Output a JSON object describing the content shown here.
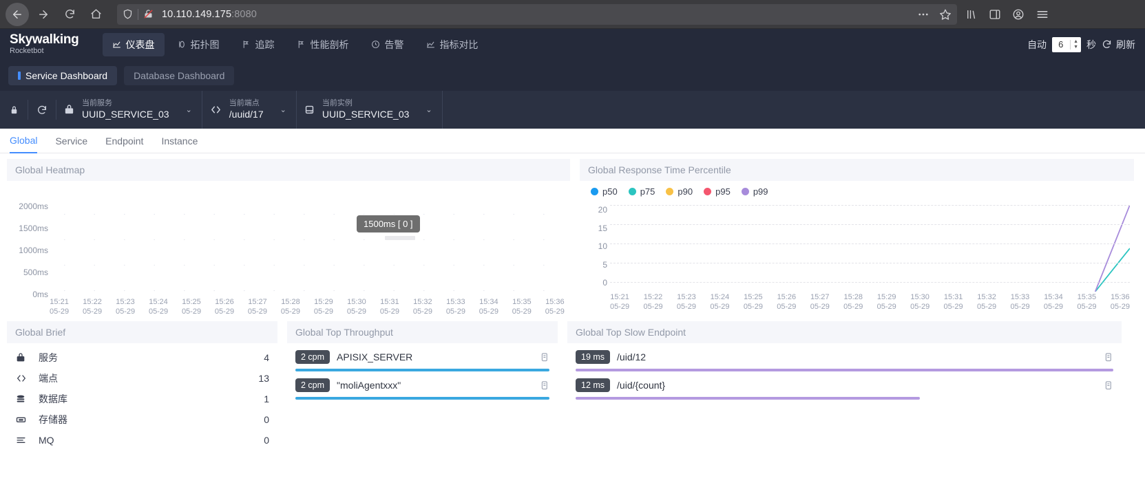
{
  "browser": {
    "url_host": "10.110.149.175",
    "url_port": ":8080",
    "back_icon": "back-arrow-icon",
    "forward_icon": "forward-arrow-icon",
    "reload_icon": "reload-icon",
    "home_icon": "home-icon",
    "shield_icon": "shield-icon",
    "broken-lock_icon": "broken-lock-icon",
    "more_icon": "ellipsis-icon",
    "bookmark_icon": "star-icon",
    "library_icon": "library-icon",
    "sidebar_icon": "sidebar-icon",
    "account_icon": "account-icon",
    "menu_icon": "hamburger-menu-icon"
  },
  "header": {
    "logo_main": "Skywalking",
    "logo_sub": "Rocketbot",
    "nav": [
      {
        "label": "仪表盘",
        "icon": "dashboard-icon",
        "active": true
      },
      {
        "label": "拓扑图",
        "icon": "topology-icon",
        "active": false
      },
      {
        "label": "追踪",
        "icon": "trace-icon",
        "active": false
      },
      {
        "label": "性能剖析",
        "icon": "profile-icon",
        "active": false
      },
      {
        "label": "告警",
        "icon": "alarm-icon",
        "active": false
      },
      {
        "label": "指标对比",
        "icon": "compare-icon",
        "active": false
      }
    ],
    "auto_label": "自动",
    "auto_value": "6",
    "seconds_label": "秒",
    "refresh_label": "刷新",
    "refresh_icon": "refresh-icon"
  },
  "dashboard_tabs": [
    {
      "label": "Service Dashboard",
      "active": true
    },
    {
      "label": "Database Dashboard",
      "active": false
    }
  ],
  "condition_bar": {
    "lock_icon": "lock-icon",
    "reload_icon": "reload-icon",
    "selectors": [
      {
        "icon": "service-icon",
        "label": "当前服务",
        "value": "UUID_SERVICE_03"
      },
      {
        "icon": "endpoint-icon",
        "label": "当前端点",
        "value": "/uuid/17"
      },
      {
        "icon": "instance-icon",
        "label": "当前实例",
        "value": "UUID_SERVICE_03"
      }
    ]
  },
  "page_tabs": [
    {
      "label": "Global",
      "active": true
    },
    {
      "label": "Service",
      "active": false
    },
    {
      "label": "Endpoint",
      "active": false
    },
    {
      "label": "Instance",
      "active": false
    }
  ],
  "panels": {
    "heatmap": {
      "title": "Global Heatmap",
      "tooltip": "1500ms [ 0 ]"
    },
    "percentile": {
      "title": "Global Response Time Percentile"
    },
    "brief": {
      "title": "Global Brief",
      "rows": [
        {
          "icon": "service-icon",
          "label": "服务",
          "value": "4"
        },
        {
          "icon": "endpoint-icon",
          "label": "端点",
          "value": "13"
        },
        {
          "icon": "database-icon",
          "label": "数据库",
          "value": "1"
        },
        {
          "icon": "cache-icon",
          "label": "存储器",
          "value": "0"
        },
        {
          "icon": "mq-icon",
          "label": "MQ",
          "value": "0"
        }
      ]
    },
    "top_throughput": {
      "title": "Global Top Throughput",
      "items": [
        {
          "badge": "2 cpm",
          "name": "APISIX_SERVER",
          "pct": 100,
          "color": "#3aa8e0"
        },
        {
          "badge": "2 cpm",
          "name": "\"moliAgentxxx\"",
          "pct": 100,
          "color": "#3aa8e0"
        }
      ]
    },
    "top_slow_endpoint": {
      "title": "Global Top Slow Endpoint",
      "items": [
        {
          "badge": "19 ms",
          "name": "/uid/12",
          "pct": 100,
          "color": "#b49ae0"
        },
        {
          "badge": "12 ms",
          "name": "/uid/{count}",
          "pct": 64,
          "color": "#b49ae0"
        }
      ]
    }
  },
  "chart_data": [
    {
      "type": "heatmap",
      "title": "Global Heatmap",
      "ylabel": "",
      "xlabel": "",
      "yticks": [
        "2000ms",
        "1500ms",
        "1000ms",
        "500ms",
        "0ms"
      ],
      "ylim": [
        0,
        2000
      ],
      "grid": true,
      "xticks": [
        "15:21\n05-29",
        "15:22\n05-29",
        "15:23\n05-29",
        "15:24\n05-29",
        "15:25\n05-29",
        "15:26\n05-29",
        "15:27\n05-29",
        "15:28\n05-29",
        "15:29\n05-29",
        "15:30\n05-29",
        "15:31\n05-29",
        "15:32\n05-29",
        "15:33\n05-29",
        "15:34\n05-29",
        "15:35\n05-29",
        "15:36\n05-29"
      ],
      "x": [
        "15:21",
        "15:22",
        "15:23",
        "15:24",
        "15:25",
        "15:26",
        "15:27",
        "15:28",
        "15:29",
        "15:30",
        "15:31",
        "15:32",
        "15:33",
        "15:34",
        "15:35",
        "15:36"
      ],
      "dates": [
        "05-29",
        "05-29",
        "05-29",
        "05-29",
        "05-29",
        "05-29",
        "05-29",
        "05-29",
        "05-29",
        "05-29",
        "05-29",
        "05-29",
        "05-29",
        "05-29",
        "05-29",
        "05-29"
      ],
      "values": [],
      "annotation": "1500ms [ 0 ]"
    },
    {
      "type": "line",
      "title": "Global Response Time Percentile",
      "xlabel": "",
      "ylabel": "",
      "ylim": [
        0,
        20
      ],
      "yticks": [
        0,
        5,
        10,
        15,
        20
      ],
      "grid": true,
      "legend_position": "top-left",
      "x": [
        "15:21",
        "15:22",
        "15:23",
        "15:24",
        "15:25",
        "15:26",
        "15:27",
        "15:28",
        "15:29",
        "15:30",
        "15:31",
        "15:32",
        "15:33",
        "15:34",
        "15:35",
        "15:36"
      ],
      "dates": [
        "05-29",
        "05-29",
        "05-29",
        "05-29",
        "05-29",
        "05-29",
        "05-29",
        "05-29",
        "05-29",
        "05-29",
        "05-29",
        "05-29",
        "05-29",
        "05-29",
        "05-29",
        "05-29"
      ],
      "series": [
        {
          "name": "p50",
          "color": "#1a9bf0",
          "values": [
            0,
            0,
            0,
            0,
            0,
            0,
            0,
            0,
            0,
            0,
            0,
            0,
            0,
            0,
            0,
            0
          ]
        },
        {
          "name": "p75",
          "color": "#2bc4c0",
          "values": [
            0,
            0,
            0,
            0,
            0,
            0,
            0,
            0,
            0,
            0,
            0,
            0,
            0,
            0,
            0,
            10
          ]
        },
        {
          "name": "p90",
          "color": "#f8c146",
          "values": [
            0,
            0,
            0,
            0,
            0,
            0,
            0,
            0,
            0,
            0,
            0,
            0,
            0,
            0,
            0,
            0
          ]
        },
        {
          "name": "p95",
          "color": "#f4566e",
          "values": [
            0,
            0,
            0,
            0,
            0,
            0,
            0,
            0,
            0,
            0,
            0,
            0,
            0,
            0,
            0,
            0
          ]
        },
        {
          "name": "p99",
          "color": "#a78bdb",
          "values": [
            0,
            0,
            0,
            0,
            0,
            0,
            0,
            0,
            0,
            0,
            0,
            0,
            0,
            0,
            0,
            20
          ]
        }
      ]
    }
  ]
}
